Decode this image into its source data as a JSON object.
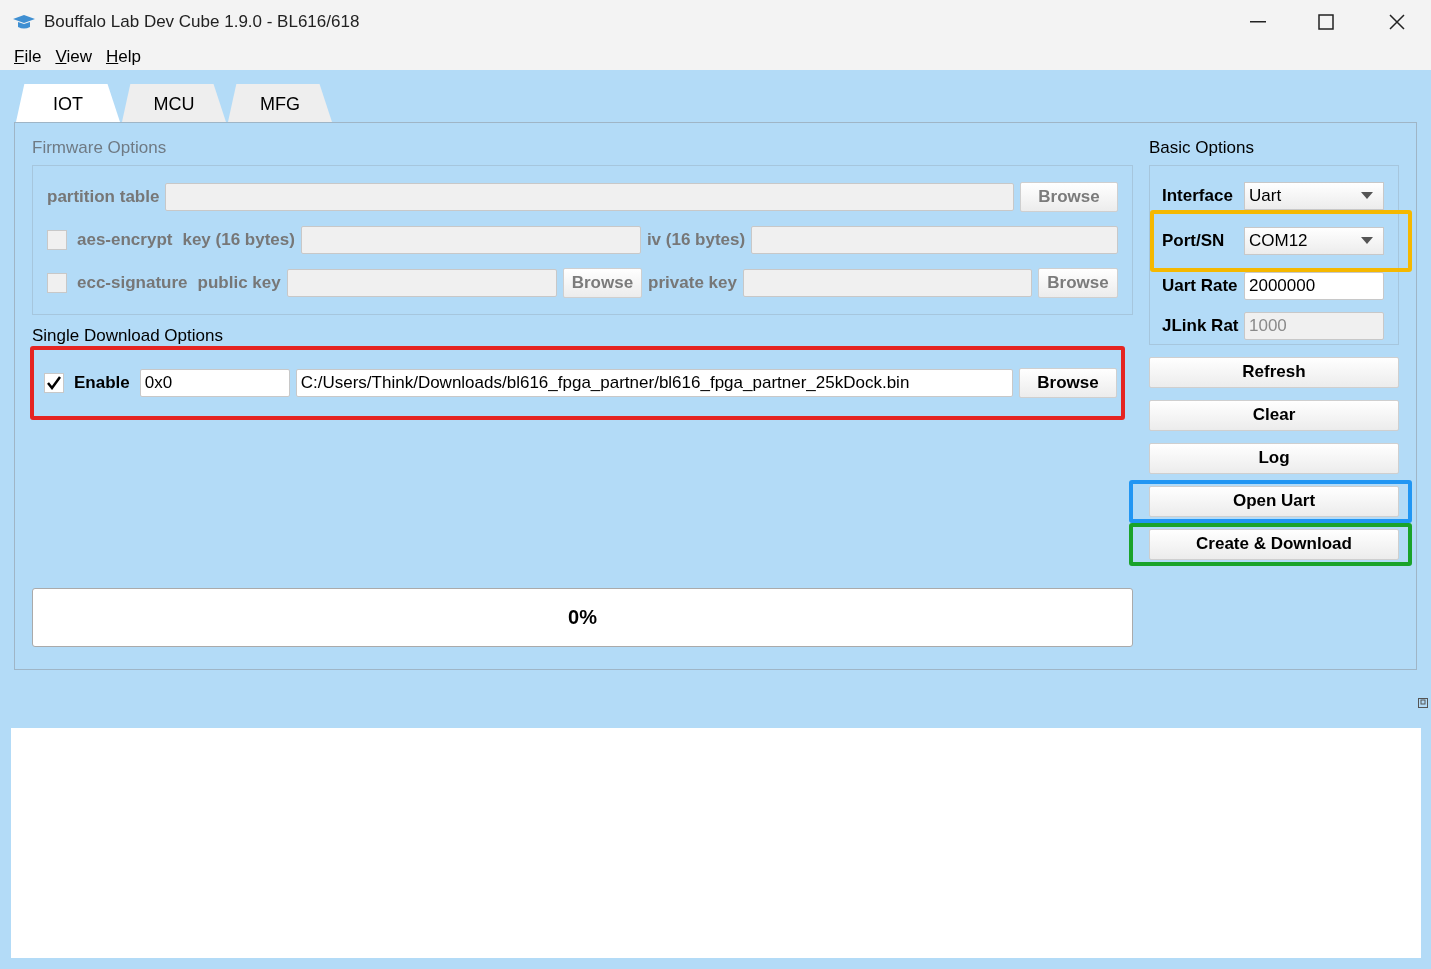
{
  "window": {
    "title": "Bouffalo Lab Dev Cube 1.9.0 - BL616/618"
  },
  "menu": [
    {
      "label": "File"
    },
    {
      "label": "View"
    },
    {
      "label": "Help"
    }
  ],
  "tabs": [
    {
      "label": "IOT",
      "selected": true
    },
    {
      "label": "MCU",
      "selected": false
    },
    {
      "label": "MFG",
      "selected": false
    }
  ],
  "firmware_options": {
    "title": "Firmware Options",
    "disabled": true,
    "partition_table": {
      "label": "partition table",
      "button": "Browse"
    },
    "aes": {
      "label": "aes-encrypt",
      "checked": false,
      "key_label": "key (16 bytes)",
      "iv_label": "iv (16 bytes)"
    },
    "ecc": {
      "label": "ecc-signature",
      "checked": false,
      "public_label": "public key",
      "public_button": "Browse",
      "private_label": "private key",
      "private_button": "Browse"
    }
  },
  "single_download": {
    "title": "Single Download Options",
    "color": "#e52421",
    "enable_label": "Enable",
    "checked": true,
    "address": "0x0",
    "path": "C:/Users/Think/Downloads/bl616_fpga_partner/bl616_fpga_partner_25kDock.bin",
    "button": "Browse"
  },
  "progress": {
    "label": "0%",
    "level": 0
  },
  "basic_options": {
    "title": "Basic Options",
    "fields": [
      {
        "label": "Interface",
        "kind": "dropdown",
        "value": "Uart",
        "disabled": false
      },
      {
        "label": "Port/SN",
        "kind": "dropdown",
        "value": "COM12",
        "disabled": false,
        "color": "#f5b800"
      },
      {
        "label": "Uart Rate",
        "kind": "input",
        "value": "2000000",
        "disabled": false
      },
      {
        "label": "JLink Rat",
        "kind": "input",
        "value": "1000",
        "disabled": true
      }
    ]
  },
  "buttons": [
    {
      "label": "Refresh"
    },
    {
      "label": "Clear"
    },
    {
      "label": "Log"
    },
    {
      "label": "Open Uart",
      "color": "#2196f3"
    },
    {
      "label": "Create & Download",
      "color": "#1aa32a"
    }
  ]
}
